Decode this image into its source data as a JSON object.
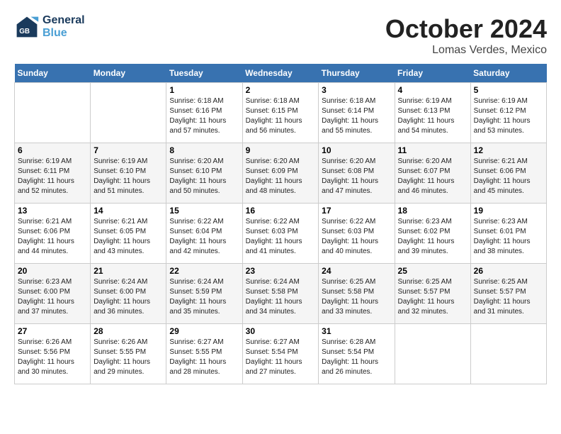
{
  "header": {
    "logo_line1": "General",
    "logo_line2": "Blue",
    "month": "October 2024",
    "location": "Lomas Verdes, Mexico"
  },
  "weekdays": [
    "Sunday",
    "Monday",
    "Tuesday",
    "Wednesday",
    "Thursday",
    "Friday",
    "Saturday"
  ],
  "weeks": [
    [
      {
        "day": "",
        "content": ""
      },
      {
        "day": "",
        "content": ""
      },
      {
        "day": "1",
        "content": "Sunrise: 6:18 AM\nSunset: 6:16 PM\nDaylight: 11 hours\nand 57 minutes."
      },
      {
        "day": "2",
        "content": "Sunrise: 6:18 AM\nSunset: 6:15 PM\nDaylight: 11 hours\nand 56 minutes."
      },
      {
        "day": "3",
        "content": "Sunrise: 6:18 AM\nSunset: 6:14 PM\nDaylight: 11 hours\nand 55 minutes."
      },
      {
        "day": "4",
        "content": "Sunrise: 6:19 AM\nSunset: 6:13 PM\nDaylight: 11 hours\nand 54 minutes."
      },
      {
        "day": "5",
        "content": "Sunrise: 6:19 AM\nSunset: 6:12 PM\nDaylight: 11 hours\nand 53 minutes."
      }
    ],
    [
      {
        "day": "6",
        "content": "Sunrise: 6:19 AM\nSunset: 6:11 PM\nDaylight: 11 hours\nand 52 minutes."
      },
      {
        "day": "7",
        "content": "Sunrise: 6:19 AM\nSunset: 6:10 PM\nDaylight: 11 hours\nand 51 minutes."
      },
      {
        "day": "8",
        "content": "Sunrise: 6:20 AM\nSunset: 6:10 PM\nDaylight: 11 hours\nand 50 minutes."
      },
      {
        "day": "9",
        "content": "Sunrise: 6:20 AM\nSunset: 6:09 PM\nDaylight: 11 hours\nand 48 minutes."
      },
      {
        "day": "10",
        "content": "Sunrise: 6:20 AM\nSunset: 6:08 PM\nDaylight: 11 hours\nand 47 minutes."
      },
      {
        "day": "11",
        "content": "Sunrise: 6:20 AM\nSunset: 6:07 PM\nDaylight: 11 hours\nand 46 minutes."
      },
      {
        "day": "12",
        "content": "Sunrise: 6:21 AM\nSunset: 6:06 PM\nDaylight: 11 hours\nand 45 minutes."
      }
    ],
    [
      {
        "day": "13",
        "content": "Sunrise: 6:21 AM\nSunset: 6:06 PM\nDaylight: 11 hours\nand 44 minutes."
      },
      {
        "day": "14",
        "content": "Sunrise: 6:21 AM\nSunset: 6:05 PM\nDaylight: 11 hours\nand 43 minutes."
      },
      {
        "day": "15",
        "content": "Sunrise: 6:22 AM\nSunset: 6:04 PM\nDaylight: 11 hours\nand 42 minutes."
      },
      {
        "day": "16",
        "content": "Sunrise: 6:22 AM\nSunset: 6:03 PM\nDaylight: 11 hours\nand 41 minutes."
      },
      {
        "day": "17",
        "content": "Sunrise: 6:22 AM\nSunset: 6:03 PM\nDaylight: 11 hours\nand 40 minutes."
      },
      {
        "day": "18",
        "content": "Sunrise: 6:23 AM\nSunset: 6:02 PM\nDaylight: 11 hours\nand 39 minutes."
      },
      {
        "day": "19",
        "content": "Sunrise: 6:23 AM\nSunset: 6:01 PM\nDaylight: 11 hours\nand 38 minutes."
      }
    ],
    [
      {
        "day": "20",
        "content": "Sunrise: 6:23 AM\nSunset: 6:00 PM\nDaylight: 11 hours\nand 37 minutes."
      },
      {
        "day": "21",
        "content": "Sunrise: 6:24 AM\nSunset: 6:00 PM\nDaylight: 11 hours\nand 36 minutes."
      },
      {
        "day": "22",
        "content": "Sunrise: 6:24 AM\nSunset: 5:59 PM\nDaylight: 11 hours\nand 35 minutes."
      },
      {
        "day": "23",
        "content": "Sunrise: 6:24 AM\nSunset: 5:58 PM\nDaylight: 11 hours\nand 34 minutes."
      },
      {
        "day": "24",
        "content": "Sunrise: 6:25 AM\nSunset: 5:58 PM\nDaylight: 11 hours\nand 33 minutes."
      },
      {
        "day": "25",
        "content": "Sunrise: 6:25 AM\nSunset: 5:57 PM\nDaylight: 11 hours\nand 32 minutes."
      },
      {
        "day": "26",
        "content": "Sunrise: 6:25 AM\nSunset: 5:57 PM\nDaylight: 11 hours\nand 31 minutes."
      }
    ],
    [
      {
        "day": "27",
        "content": "Sunrise: 6:26 AM\nSunset: 5:56 PM\nDaylight: 11 hours\nand 30 minutes."
      },
      {
        "day": "28",
        "content": "Sunrise: 6:26 AM\nSunset: 5:55 PM\nDaylight: 11 hours\nand 29 minutes."
      },
      {
        "day": "29",
        "content": "Sunrise: 6:27 AM\nSunset: 5:55 PM\nDaylight: 11 hours\nand 28 minutes."
      },
      {
        "day": "30",
        "content": "Sunrise: 6:27 AM\nSunset: 5:54 PM\nDaylight: 11 hours\nand 27 minutes."
      },
      {
        "day": "31",
        "content": "Sunrise: 6:28 AM\nSunset: 5:54 PM\nDaylight: 11 hours\nand 26 minutes."
      },
      {
        "day": "",
        "content": ""
      },
      {
        "day": "",
        "content": ""
      }
    ]
  ]
}
